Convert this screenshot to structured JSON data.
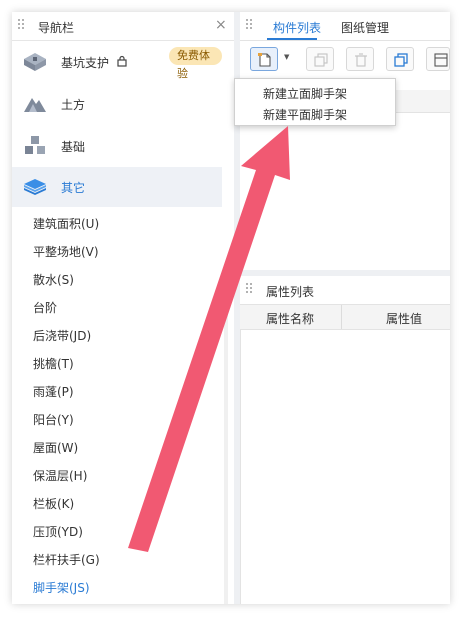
{
  "nav": {
    "title": "导航栏",
    "close": "×",
    "categories": [
      {
        "label": "基坑支护",
        "badge": "免费体验",
        "icon": "pit-support-icon"
      },
      {
        "label": "土方",
        "icon": "earthwork-icon"
      },
      {
        "label": "基础",
        "icon": "foundation-icon"
      },
      {
        "label": "其它",
        "icon": "layers-icon",
        "active": true
      }
    ],
    "items": [
      "建筑面积(U)",
      "平整场地(V)",
      "散水(S)",
      "台阶",
      "后浇带(JD)",
      "挑檐(T)",
      "雨蓬(P)",
      "阳台(Y)",
      "屋面(W)",
      "保温层(H)",
      "栏板(K)",
      "压顶(YD)",
      "栏杆扶手(G)",
      "脚手架(JS)"
    ],
    "active_item": "脚手架(JS)"
  },
  "tabs": [
    "构件列表",
    "图纸管理"
  ],
  "toolbar": {
    "buttons": [
      "new-file-icon",
      "copy-icon",
      "delete-icon",
      "duplicate-icon",
      "layer-copy-icon"
    ],
    "dropdown": "▼"
  },
  "new_menu": {
    "items": [
      "新建立面脚手架",
      "新建平面脚手架"
    ]
  },
  "properties": {
    "title": "属性列表",
    "columns": [
      "属性名称",
      "属性值"
    ]
  },
  "colors": {
    "accent": "#2a7bd4",
    "arrow": "#f0506a",
    "badge_bg": "#fbe6b5"
  }
}
